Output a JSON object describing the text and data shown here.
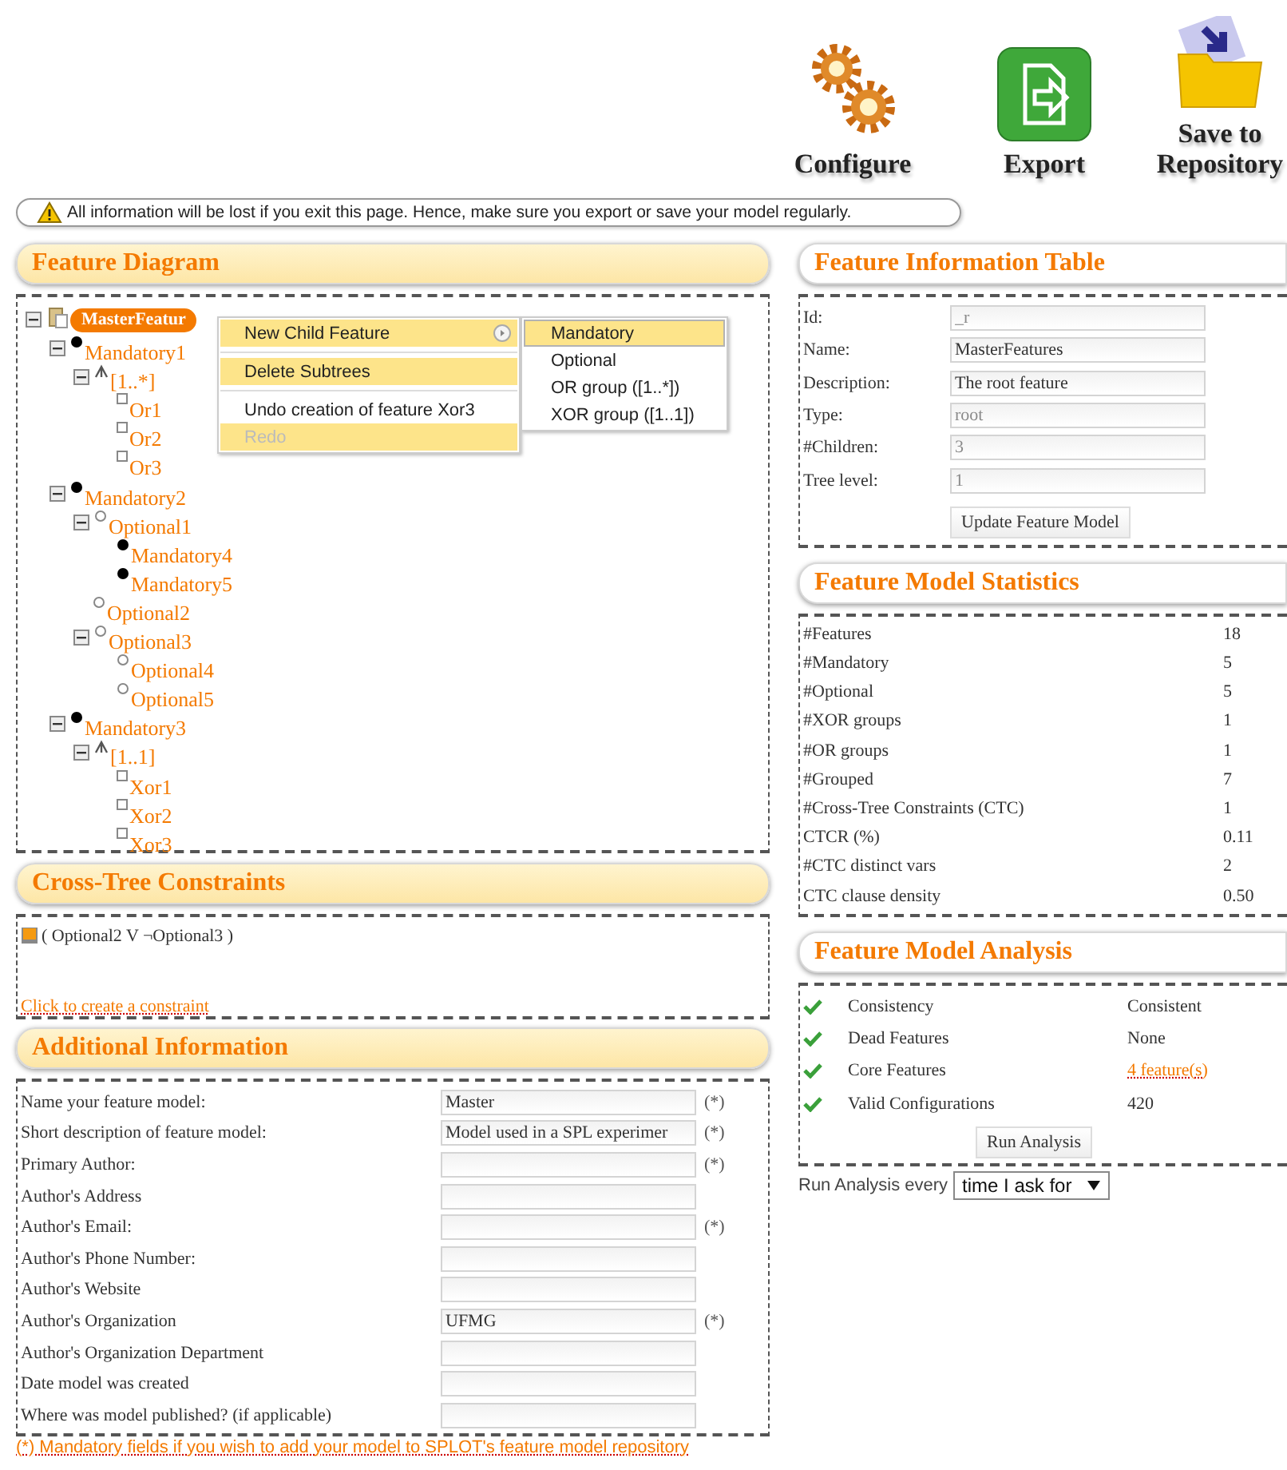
{
  "toolbar": {
    "buttons": [
      {
        "kind": "configure",
        "label": "Configure"
      },
      {
        "kind": "export",
        "label": "Export"
      },
      {
        "kind": "save",
        "label": "Save to Repository"
      }
    ]
  },
  "warning": "All information will be lost if you exit this page. Hence, make sure you export or save your model regularly.",
  "feature_diagram": {
    "title": "Feature Diagram",
    "tree": [
      {
        "kind": "root",
        "label": "MasterFeatur",
        "children": [
          {
            "kind": "mandatory",
            "label": "Mandatory1",
            "children": [
              {
                "kind": "group",
                "label": "[1..*]",
                "children": [
                  {
                    "kind": "grouped",
                    "label": "Or1"
                  },
                  {
                    "kind": "grouped",
                    "label": "Or2"
                  },
                  {
                    "kind": "grouped",
                    "label": "Or3"
                  }
                ]
              }
            ]
          },
          {
            "kind": "mandatory",
            "label": "Mandatory2",
            "children": [
              {
                "kind": "optional",
                "label": "Optional1",
                "children": [
                  {
                    "kind": "mandatory",
                    "label": "Mandatory4"
                  },
                  {
                    "kind": "mandatory",
                    "label": "Mandatory5"
                  }
                ]
              },
              {
                "kind": "optional",
                "label": "Optional2"
              },
              {
                "kind": "optional",
                "label": "Optional3",
                "children": [
                  {
                    "kind": "optional",
                    "label": "Optional4"
                  },
                  {
                    "kind": "optional",
                    "label": "Optional5"
                  }
                ]
              }
            ]
          },
          {
            "kind": "mandatory",
            "label": "Mandatory3",
            "children": [
              {
                "kind": "group",
                "label": "[1..1]",
                "children": [
                  {
                    "kind": "grouped",
                    "label": "Xor1"
                  },
                  {
                    "kind": "grouped",
                    "label": "Xor2"
                  },
                  {
                    "kind": "grouped",
                    "label": "Xor3"
                  }
                ]
              }
            ]
          }
        ]
      }
    ],
    "context_menu": {
      "items": [
        {
          "kind": "item",
          "label": "New Child Feature",
          "highlighted": true,
          "disabled": false,
          "submenu": true
        },
        {
          "kind": "separator"
        },
        {
          "kind": "item",
          "label": "Delete Subtrees",
          "highlighted": true,
          "disabled": false,
          "submenu": false
        },
        {
          "kind": "separator"
        },
        {
          "kind": "item",
          "label": "Undo creation of feature Xor3",
          "highlighted": false,
          "disabled": false,
          "submenu": false
        },
        {
          "kind": "item",
          "label": "Redo",
          "highlighted": true,
          "disabled": true,
          "submenu": false
        }
      ],
      "submenu": [
        {
          "label": "Mandatory",
          "selected": true
        },
        {
          "label": "Optional",
          "selected": false
        },
        {
          "label": "OR group ([1..*])",
          "selected": false
        },
        {
          "label": "XOR group ([1..1])",
          "selected": false
        }
      ]
    }
  },
  "cross_tree_constraints": {
    "title": "Cross-Tree Constraints",
    "constraints": [
      "( Optional2 V ¬Optional3 )"
    ],
    "link": "Click to create a constraint"
  },
  "additional_information": {
    "title": "Additional Information",
    "rows": [
      {
        "label": "Name your feature model:",
        "value": "Master",
        "marker": "(*)"
      },
      {
        "label": "Short description of feature model:",
        "value": "Model used in a SPL experimer",
        "marker": "(*)"
      },
      {
        "label": "Primary Author:",
        "marker": "(*)"
      },
      {
        "label": "Author's Address"
      },
      {
        "label": "Author's Email:",
        "marker": "(*)"
      },
      {
        "label": "Author's Phone Number:"
      },
      {
        "label": "Author's Website"
      },
      {
        "label": "Author's Organization",
        "value": "UFMG",
        "marker": "(*)"
      },
      {
        "label": "Author's Organization Department"
      },
      {
        "label": "Date model was created"
      },
      {
        "label": "Where was model published? (if applicable)"
      }
    ],
    "note": "(*) Mandatory fields if you wish to add your model to SPLOT's feature model repository"
  },
  "feature_information_table": {
    "title": "Feature Information Table",
    "rows": [
      {
        "label": "Id:",
        "value": "_r",
        "disabled": true
      },
      {
        "label": "Name:",
        "value": "MasterFeatures",
        "disabled": false
      },
      {
        "label": "Description:",
        "value": "The root feature",
        "disabled": false
      },
      {
        "label": "Type:",
        "value": "root",
        "disabled": true
      },
      {
        "label": "#Children:",
        "value": "3",
        "disabled": true
      },
      {
        "label": "Tree level:",
        "value": "1",
        "disabled": true
      }
    ],
    "button": "Update Feature Model"
  },
  "feature_model_statistics": {
    "title": "Feature Model Statistics",
    "rows": [
      {
        "label": "#Features",
        "value": "18"
      },
      {
        "label": "#Mandatory",
        "value": "5"
      },
      {
        "label": "#Optional",
        "value": "5"
      },
      {
        "label": "#XOR groups",
        "value": "1"
      },
      {
        "label": "#OR groups",
        "value": "1"
      },
      {
        "label": "#Grouped",
        "value": "7"
      },
      {
        "label": "#Cross-Tree Constraints (CTC)",
        "value": "1"
      },
      {
        "label": "CTCR (%)",
        "value": "0.11"
      },
      {
        "label": "#CTC distinct vars",
        "value": "2"
      },
      {
        "label": "CTC clause density",
        "value": "0.50"
      }
    ]
  },
  "feature_model_analysis": {
    "title": "Feature Model Analysis",
    "rows": [
      {
        "label": "Consistency",
        "value": "Consistent",
        "passed": true,
        "kind": "text"
      },
      {
        "label": "Dead Features",
        "value": "None",
        "passed": true,
        "kind": "text"
      },
      {
        "label": "Core Features",
        "value": "4 feature(s)",
        "passed": true,
        "kind": "link"
      },
      {
        "label": "Valid Configurations",
        "value": "420",
        "passed": true,
        "kind": "text"
      }
    ],
    "button": "Run Analysis",
    "schedule_label": "Run Analysis every",
    "schedule_value": "time I ask for"
  }
}
